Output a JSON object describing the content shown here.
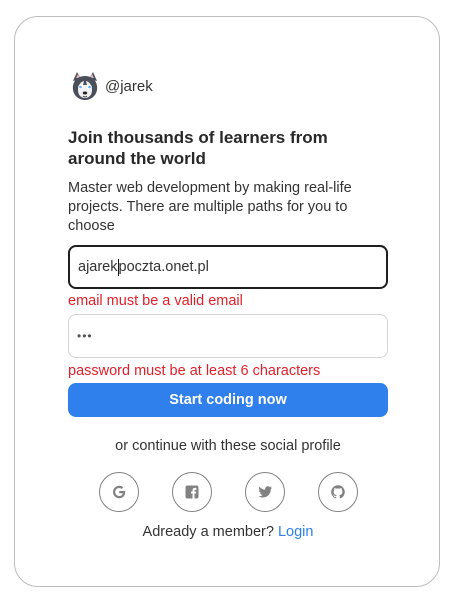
{
  "brand": {
    "username": "@jarek",
    "logo_icon": "husky-avatar-icon"
  },
  "headline": "Join thousands of learners from around the world",
  "intro": "Master web development by making real-life projects. There are multiple paths for you to choose",
  "email": {
    "value_before_caret": "ajarek",
    "value_after_caret": "poczta.onet.pl",
    "error": "email must be a valid email"
  },
  "password": {
    "masked_value": "•••",
    "error": "password must be at least 6 characters"
  },
  "submit_label": "Start coding now",
  "social": {
    "text": "or continue with these social profile",
    "providers": [
      "google-icon",
      "facebook-icon",
      "twitter-icon",
      "github-icon"
    ]
  },
  "footer": {
    "prompt": "Adready a member?",
    "login_link": "Login"
  },
  "colors": {
    "accent": "#2f80ed",
    "error": "#e0202b",
    "border": "#bdbdbd"
  }
}
